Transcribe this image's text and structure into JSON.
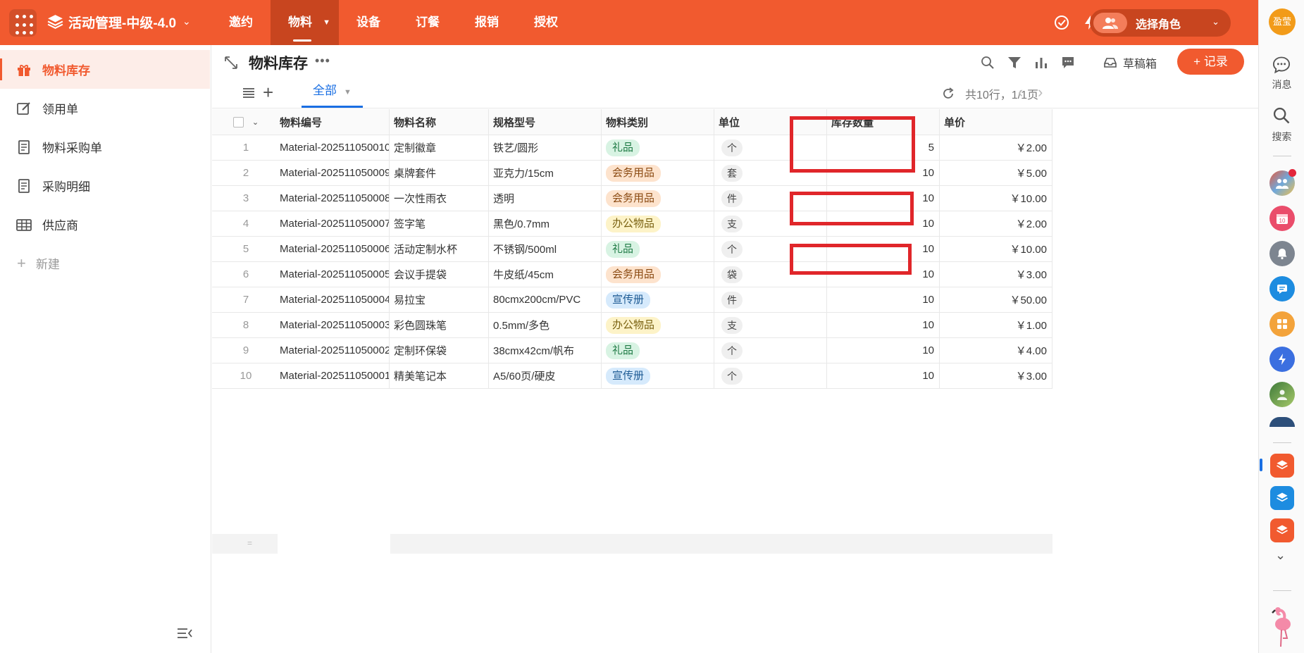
{
  "app": {
    "title": "活动管理-中级-4.0"
  },
  "nav": {
    "items": [
      {
        "label": "邀约"
      },
      {
        "label": "物料"
      },
      {
        "label": "设备"
      },
      {
        "label": "订餐"
      },
      {
        "label": "报销"
      },
      {
        "label": "授权"
      }
    ],
    "active_index": 1,
    "role_label": "选择角色"
  },
  "rail": {
    "user_avatar": "盈莹",
    "messages_label": "消息",
    "search_label": "搜索",
    "calendar_day": "10"
  },
  "sidebar": {
    "items": [
      {
        "label": "物料库存",
        "icon": "gift-icon"
      },
      {
        "label": "领用单",
        "icon": "edit-icon"
      },
      {
        "label": "物料采购单",
        "icon": "document-icon"
      },
      {
        "label": "采购明细",
        "icon": "document-icon"
      },
      {
        "label": "供应商",
        "icon": "table-icon"
      }
    ],
    "add_label": "新建"
  },
  "page": {
    "title": "物料库存",
    "drafts_label": "草稿箱",
    "record_label": "+ 记录",
    "tab_label": "全部",
    "pager_text": "共10行，1/1页"
  },
  "table": {
    "columns": [
      "物料编号",
      "物料名称",
      "规格型号",
      "物料类别",
      "单位",
      "库存数量",
      "单价"
    ],
    "rows": [
      {
        "idx": "1",
        "code": "Material-202511050010",
        "name": "定制徽章",
        "spec": "铁艺/圆形",
        "category": "礼品",
        "unit": "个",
        "qty": "5",
        "price": "￥2.00"
      },
      {
        "idx": "2",
        "code": "Material-202511050009",
        "name": "桌牌套件",
        "spec": "亚克力/15cm",
        "category": "会务用品",
        "unit": "套",
        "qty": "10",
        "price": "￥5.00"
      },
      {
        "idx": "3",
        "code": "Material-202511050008",
        "name": "一次性雨衣",
        "spec": "透明",
        "category": "会务用品",
        "unit": "件",
        "qty": "10",
        "price": "￥10.00"
      },
      {
        "idx": "4",
        "code": "Material-202511050007",
        "name": "签字笔",
        "spec": "黑色/0.7mm",
        "category": "办公物品",
        "unit": "支",
        "qty": "10",
        "price": "￥2.00"
      },
      {
        "idx": "5",
        "code": "Material-202511050006",
        "name": "活动定制水杯",
        "spec": "不锈钢/500ml",
        "category": "礼品",
        "unit": "个",
        "qty": "10",
        "price": "￥10.00"
      },
      {
        "idx": "6",
        "code": "Material-202511050005",
        "name": "会议手提袋",
        "spec": "牛皮纸/45cm",
        "category": "会务用品",
        "unit": "袋",
        "qty": "10",
        "price": "￥3.00"
      },
      {
        "idx": "7",
        "code": "Material-202511050004",
        "name": "易拉宝",
        "spec": "80cmx200cm/PVC",
        "category": "宣传册",
        "unit": "件",
        "qty": "10",
        "price": "￥50.00"
      },
      {
        "idx": "8",
        "code": "Material-202511050003",
        "name": "彩色圆珠笔",
        "spec": "0.5mm/多色",
        "category": "办公物品",
        "unit": "支",
        "qty": "10",
        "price": "￥1.00"
      },
      {
        "idx": "9",
        "code": "Material-202511050002",
        "name": "定制环保袋",
        "spec": "38cmx42cm/帆布",
        "category": "礼品",
        "unit": "个",
        "qty": "10",
        "price": "￥4.00"
      },
      {
        "idx": "10",
        "code": "Material-202511050001",
        "name": "精美笔记本",
        "spec": "A5/60页/硬皮",
        "category": "宣传册",
        "unit": "个",
        "qty": "10",
        "price": "￥3.00"
      }
    ],
    "footer_sum": "="
  },
  "category_colors": {
    "礼品": {
      "bg": "#d8f3e3",
      "fg": "#1f7a45"
    },
    "会务用品": {
      "bg": "#fde3cd",
      "fg": "#8a4a12"
    },
    "办公物品": {
      "bg": "#fdf3c8",
      "fg": "#7a6212"
    },
    "宣传册": {
      "bg": "#d6eafc",
      "fg": "#1e5b94"
    }
  },
  "colors": {
    "accent": "#f15a2f",
    "link": "#1a6fe3",
    "highlight": "#e0262a"
  }
}
